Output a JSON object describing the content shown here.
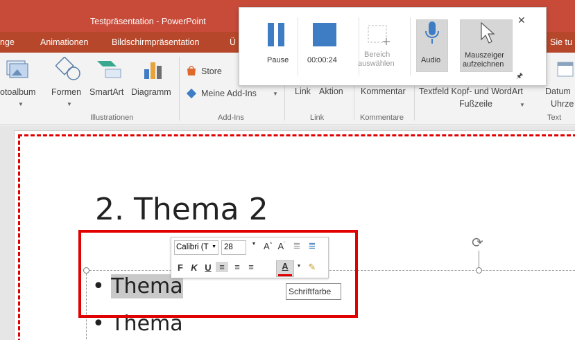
{
  "window": {
    "title": "Testpräsentation - PowerPoint"
  },
  "tabs": [
    {
      "label": "nge"
    },
    {
      "label": "Animationen"
    },
    {
      "label": "Bildschirmpräsentation"
    },
    {
      "label": "Ü"
    },
    {
      "label": "Sie tu"
    }
  ],
  "ribbon": {
    "fotoalbum": "otoalbum",
    "formen": "Formen",
    "smartart": "SmartArt",
    "diagramm": "Diagramm",
    "group_illustrationen": "Illustrationen",
    "store": "Store",
    "meine_addins": "Meine Add-Ins",
    "group_addins": "Add-Ins",
    "link": "Link",
    "aktion": "Aktion",
    "group_link": "Link",
    "kommentar": "Kommentar",
    "group_kommentare": "Kommentare",
    "textfeld_line1": "Textfeld Kopf- und WordArt",
    "textfeld_line2": "Fußzeile",
    "datum_line1": "Datum",
    "datum_line2": "Uhrze",
    "group_text": "Text"
  },
  "recorder": {
    "pause_label": "Pause",
    "timer": "00:00:24",
    "bereich_label_1": "Bereich",
    "bereich_label_2": "auswählen",
    "audio_label": "Audio",
    "mauszeiger_label_1": "Mauszeiger",
    "mauszeiger_label_2": "aufzeichnen",
    "close_glyph": "✕",
    "pin_glyph": "🖈"
  },
  "slide": {
    "title": "2. Thema 2",
    "bullets": [
      "Thema",
      "Thema"
    ]
  },
  "mini_toolbar": {
    "font": "Calibri (T",
    "size": "28",
    "bold": "F",
    "italic": "K",
    "underline": "U",
    "font_color": "A",
    "tooltip": "Schriftfarbe"
  },
  "colors": {
    "title_bar": "#c84b3a",
    "tabs_bar": "#b7472a",
    "recorder_accent": "#3e7cc3",
    "highlight_red": "#e00000",
    "font_color_bar": "#e00000"
  }
}
